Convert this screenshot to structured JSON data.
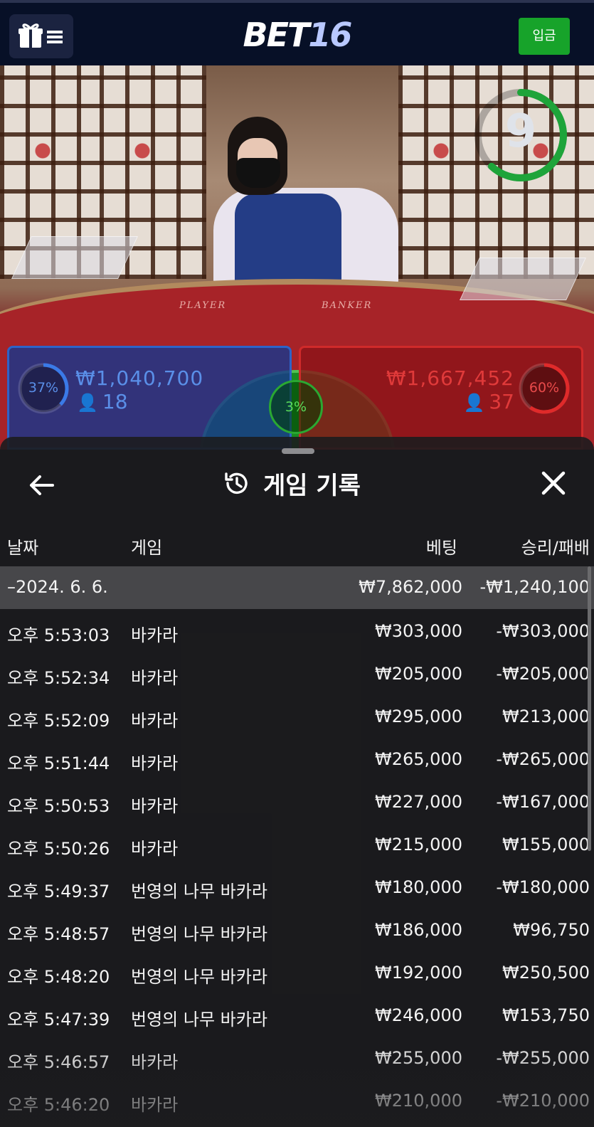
{
  "header": {
    "logo_part1": "BET",
    "logo_part2": "16",
    "deposit_label": "입금"
  },
  "video": {
    "timer_value": "9",
    "felt_player": "PLAYER",
    "felt_banker": "BANKER"
  },
  "bets": {
    "player": {
      "percent": "37%",
      "amount": "₩1,040,700",
      "count": "18"
    },
    "tie": {
      "percent": "3%"
    },
    "banker": {
      "percent": "60%",
      "amount": "₩1,667,452",
      "count": "37"
    }
  },
  "history": {
    "title": "게임 기록",
    "columns": {
      "date": "날짜",
      "game": "게임",
      "bet": "베팅",
      "result": "승리/패배"
    },
    "date_group": {
      "date": "–2024. 6. 6.",
      "bet": "₩7,862,000",
      "result": "-₩1,240,100"
    },
    "rows": [
      {
        "time": "오후 5:53:03",
        "game": "바카라",
        "bet": "₩303,000",
        "result": "-₩303,000"
      },
      {
        "time": "오후 5:52:34",
        "game": "바카라",
        "bet": "₩205,000",
        "result": "-₩205,000"
      },
      {
        "time": "오후 5:52:09",
        "game": "바카라",
        "bet": "₩295,000",
        "result": "₩213,000"
      },
      {
        "time": "오후 5:51:44",
        "game": "바카라",
        "bet": "₩265,000",
        "result": "-₩265,000"
      },
      {
        "time": "오후 5:50:53",
        "game": "바카라",
        "bet": "₩227,000",
        "result": "-₩167,000"
      },
      {
        "time": "오후 5:50:26",
        "game": "바카라",
        "bet": "₩215,000",
        "result": "₩155,000"
      },
      {
        "time": "오후 5:49:37",
        "game": "번영의 나무 바카라",
        "bet": "₩180,000",
        "result": "-₩180,000"
      },
      {
        "time": "오후 5:48:57",
        "game": "번영의 나무 바카라",
        "bet": "₩186,000",
        "result": "₩96,750"
      },
      {
        "time": "오후 5:48:20",
        "game": "번영의 나무 바카라",
        "bet": "₩192,000",
        "result": "₩250,500"
      },
      {
        "time": "오후 5:47:39",
        "game": "번영의 나무 바카라",
        "bet": "₩246,000",
        "result": "₩153,750"
      },
      {
        "time": "오후 5:46:57",
        "game": "바카라",
        "bet": "₩255,000",
        "result": "-₩255,000"
      },
      {
        "time": "오후 5:46:20",
        "game": "바카라",
        "bet": "₩210,000",
        "result": "-₩210,000"
      }
    ]
  },
  "colors": {
    "accent_green": "#17a32a",
    "player_blue": "#2d63c8",
    "banker_red": "#d02a2a"
  }
}
